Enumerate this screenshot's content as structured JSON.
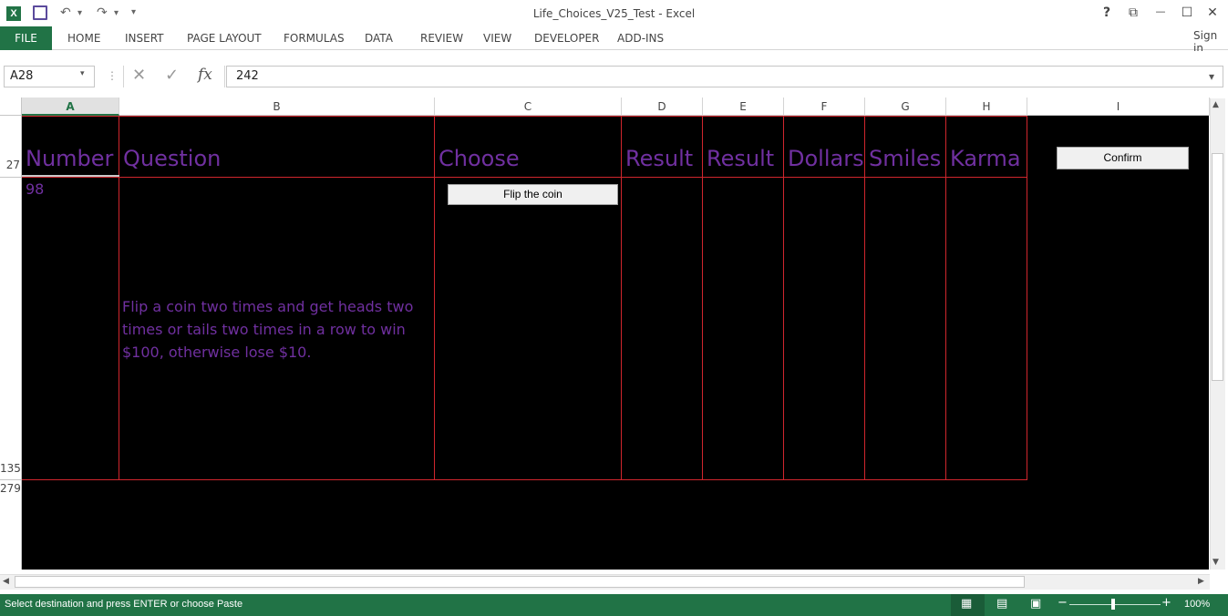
{
  "window": {
    "title": "Life_Choices_V25_Test - Excel",
    "help": "?",
    "restore_ribbon": "⧉",
    "minimize": "—",
    "maximize": "☐",
    "close": "✕"
  },
  "quick_access": {
    "excel_icon": "X",
    "save_icon": "💾",
    "undo": "↶",
    "undo_more": "▾",
    "redo": "↷",
    "redo_more": "▾",
    "customize": "⋮"
  },
  "ribbon": {
    "file_tab": "FILE",
    "tabs": [
      "HOME",
      "INSERT",
      "PAGE LAYOUT",
      "FORMULAS",
      "DATA",
      "REVIEW",
      "VIEW",
      "DEVELOPER",
      "ADD-INS"
    ],
    "sign_in": "Sign in"
  },
  "formula_bar": {
    "name_box": "A28",
    "name_box_arrow": "▾",
    "separator": "⋮",
    "cancel": "✕",
    "enter": "✓",
    "fx": "fx",
    "formula": "242",
    "expand_arrow": "▾"
  },
  "columns": [
    "A",
    "B",
    "C",
    "D",
    "E",
    "F",
    "G",
    "H",
    "I"
  ],
  "rows": [
    "27",
    "135",
    "279"
  ],
  "sheet": {
    "headers": {
      "number": "Number",
      "question": "Question",
      "choose": "Choose",
      "result1": "Result",
      "result2": "Result",
      "dollars": "Dollars",
      "smiles": "Smiles",
      "karma": "Karma"
    },
    "number_value": "98",
    "question_text": "Flip a coin two times and get heads two times or tails two times in a row to win $100, otherwise lose $10.",
    "flip_button": "Flip the coin",
    "confirm_button": "Confirm"
  },
  "scrollbars": {
    "up": "▲",
    "down": "▼",
    "left": "◀",
    "right": "▶"
  },
  "status_bar": {
    "message": "Select destination and press ENTER or choose Paste",
    "view_normal_icon": "▦",
    "view_page_layout_icon": "▤",
    "view_page_break_icon": "▣",
    "zoom_out": "−",
    "zoom_in": "+",
    "zoom": "100%",
    "zoom_level": 1.0,
    "accent_color": "#217346"
  }
}
